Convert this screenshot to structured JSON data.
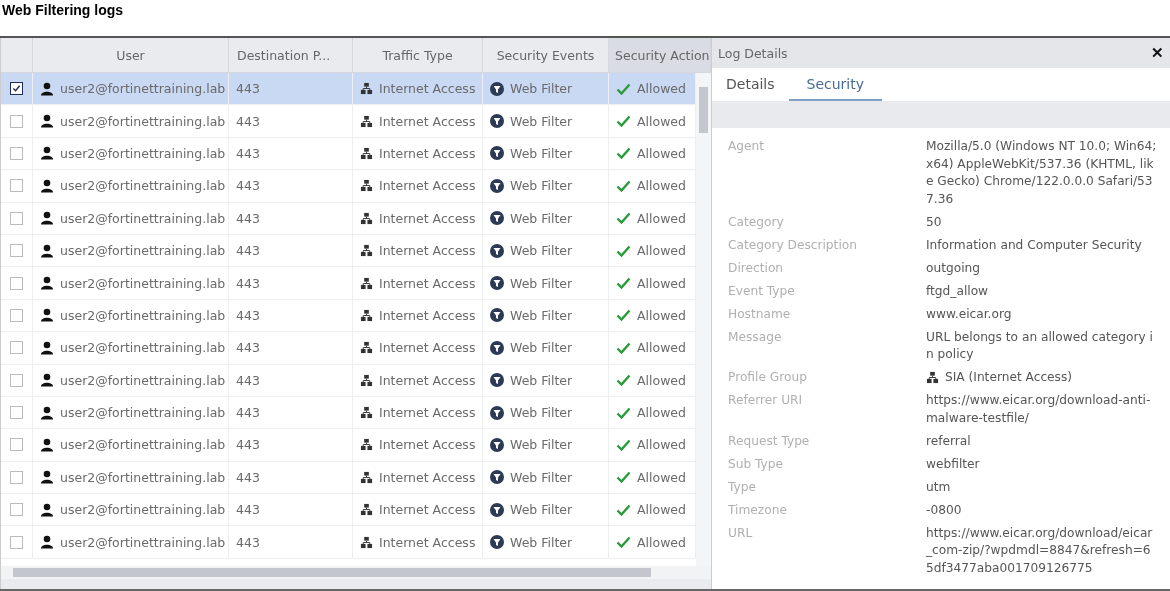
{
  "page_title": "Web Filtering logs",
  "table": {
    "columns": [
      "User",
      "Destination P...",
      "Traffic Type",
      "Security Events",
      "Security Action"
    ],
    "rows": [
      {
        "selected": true,
        "checked": true,
        "user": "user2@fortinettraining.lab",
        "port": "443",
        "traffic": "Internet Access",
        "event": "Web Filter",
        "action": "Allowed"
      },
      {
        "selected": false,
        "checked": false,
        "user": "user2@fortinettraining.lab",
        "port": "443",
        "traffic": "Internet Access",
        "event": "Web Filter",
        "action": "Allowed"
      },
      {
        "selected": false,
        "checked": false,
        "user": "user2@fortinettraining.lab",
        "port": "443",
        "traffic": "Internet Access",
        "event": "Web Filter",
        "action": "Allowed"
      },
      {
        "selected": false,
        "checked": false,
        "user": "user2@fortinettraining.lab",
        "port": "443",
        "traffic": "Internet Access",
        "event": "Web Filter",
        "action": "Allowed"
      },
      {
        "selected": false,
        "checked": false,
        "user": "user2@fortinettraining.lab",
        "port": "443",
        "traffic": "Internet Access",
        "event": "Web Filter",
        "action": "Allowed"
      },
      {
        "selected": false,
        "checked": false,
        "user": "user2@fortinettraining.lab",
        "port": "443",
        "traffic": "Internet Access",
        "event": "Web Filter",
        "action": "Allowed"
      },
      {
        "selected": false,
        "checked": false,
        "user": "user2@fortinettraining.lab",
        "port": "443",
        "traffic": "Internet Access",
        "event": "Web Filter",
        "action": "Allowed"
      },
      {
        "selected": false,
        "checked": false,
        "user": "user2@fortinettraining.lab",
        "port": "443",
        "traffic": "Internet Access",
        "event": "Web Filter",
        "action": "Allowed"
      },
      {
        "selected": false,
        "checked": false,
        "user": "user2@fortinettraining.lab",
        "port": "443",
        "traffic": "Internet Access",
        "event": "Web Filter",
        "action": "Allowed"
      },
      {
        "selected": false,
        "checked": false,
        "user": "user2@fortinettraining.lab",
        "port": "443",
        "traffic": "Internet Access",
        "event": "Web Filter",
        "action": "Allowed"
      },
      {
        "selected": false,
        "checked": false,
        "user": "user2@fortinettraining.lab",
        "port": "443",
        "traffic": "Internet Access",
        "event": "Web Filter",
        "action": "Allowed"
      },
      {
        "selected": false,
        "checked": false,
        "user": "user2@fortinettraining.lab",
        "port": "443",
        "traffic": "Internet Access",
        "event": "Web Filter",
        "action": "Allowed"
      },
      {
        "selected": false,
        "checked": false,
        "user": "user2@fortinettraining.lab",
        "port": "443",
        "traffic": "Internet Access",
        "event": "Web Filter",
        "action": "Allowed"
      },
      {
        "selected": false,
        "checked": false,
        "user": "user2@fortinettraining.lab",
        "port": "443",
        "traffic": "Internet Access",
        "event": "Web Filter",
        "action": "Allowed"
      },
      {
        "selected": false,
        "checked": false,
        "user": "user2@fortinettraining.lab",
        "port": "443",
        "traffic": "Internet Access",
        "event": "Web Filter",
        "action": "Allowed"
      }
    ]
  },
  "log_details": {
    "title": "Log Details",
    "close": "✕",
    "tabs": [
      {
        "label": "Details",
        "selected": false
      },
      {
        "label": "Security",
        "selected": true
      }
    ],
    "fields": [
      {
        "kind": "text",
        "label": "Agent",
        "value": "Mozilla/5.0 (Windows NT 10.0; Win64; x64) AppleWebKit/537.36 (KHTML, like Gecko) Chrome/122.0.0.0 Safari/537.36"
      },
      {
        "kind": "text",
        "label": "Category",
        "value": "50"
      },
      {
        "kind": "text",
        "label": "Category Description",
        "value": "Information and Computer Security"
      },
      {
        "kind": "text",
        "label": "Direction",
        "value": "outgoing"
      },
      {
        "kind": "text",
        "label": "Event Type",
        "value": "ftgd_allow"
      },
      {
        "kind": "text",
        "label": "Hostname",
        "value": "www.eicar.org"
      },
      {
        "kind": "text",
        "label": "Message",
        "value": "URL belongs to an allowed category in policy"
      },
      {
        "kind": "group",
        "label": "Profile Group",
        "value": "SIA (Internet Access)"
      },
      {
        "kind": "text",
        "label": "Referrer URI",
        "value": "https://www.eicar.org/download-anti-malware-testfile/"
      },
      {
        "kind": "text",
        "label": "Request Type",
        "value": "referral"
      },
      {
        "kind": "text",
        "label": "Sub Type",
        "value": "webfilter"
      },
      {
        "kind": "text",
        "label": "Type",
        "value": "utm"
      },
      {
        "kind": "text",
        "label": "Timezone",
        "value": "-0800"
      },
      {
        "kind": "text",
        "label": "URL",
        "value": "https://www.eicar.org/download/eicar_com-zip/?wpdmdl=8847&refresh=65df3477aba001709126775"
      }
    ]
  }
}
